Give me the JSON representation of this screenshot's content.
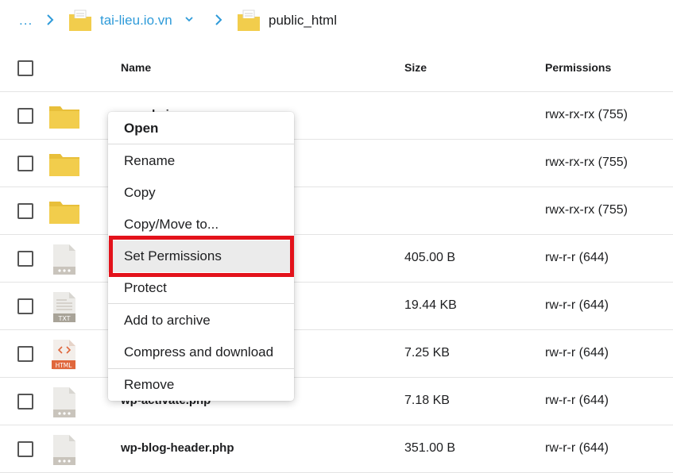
{
  "breadcrumb": {
    "ellipsis": "...",
    "items": [
      {
        "label": "tai-lieu.io.vn",
        "icon": "folder-icon",
        "has_dropdown": true
      },
      {
        "label": "public_html",
        "icon": "folder-icon",
        "has_dropdown": false
      }
    ]
  },
  "table": {
    "headers": {
      "name": "Name",
      "size": "Size",
      "permissions": "Permissions"
    },
    "rows": [
      {
        "icon": "folder-icon",
        "name": "wp-admin",
        "size": "",
        "permissions": "rwx-rx-rx (755)"
      },
      {
        "icon": "folder-icon",
        "name": "",
        "size": "",
        "permissions": "rwx-rx-rx (755)"
      },
      {
        "icon": "folder-icon",
        "name": "",
        "size": "",
        "permissions": "rwx-rx-rx (755)"
      },
      {
        "icon": "php-file-icon",
        "name": "",
        "size": "405.00 B",
        "permissions": "rw-r-r (644)"
      },
      {
        "icon": "txt-file-icon",
        "name": "",
        "size": "19.44 KB",
        "permissions": "rw-r-r (644)"
      },
      {
        "icon": "html-file-icon",
        "name": "",
        "size": "7.25 KB",
        "permissions": "rw-r-r (644)"
      },
      {
        "icon": "php-file-icon",
        "name": "wp-activate.php",
        "size": "7.18 KB",
        "permissions": "rw-r-r (644)"
      },
      {
        "icon": "php-file-icon",
        "name": "wp-blog-header.php",
        "size": "351.00 B",
        "permissions": "rw-r-r (644)"
      }
    ]
  },
  "context_menu": {
    "items": [
      {
        "label": "Open"
      },
      {
        "label": "Rename"
      },
      {
        "label": "Copy"
      },
      {
        "label": "Copy/Move to..."
      },
      {
        "label": "Set Permissions"
      },
      {
        "label": "Protect"
      },
      {
        "label": "Add to archive"
      },
      {
        "label": "Compress and download"
      },
      {
        "label": "Remove"
      }
    ],
    "highlighted": "Set Permissions"
  },
  "colors": {
    "link": "#2f9bd9",
    "folder": "#f2cd4c",
    "highlight_border": "#e3121b",
    "file_icon_gray": "#c9c4bc",
    "html_icon_orange": "#e0673c"
  }
}
